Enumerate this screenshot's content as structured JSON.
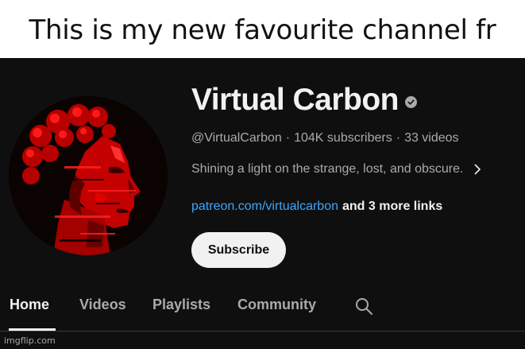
{
  "meme": {
    "caption": "This is my new favourite channel fr",
    "watermark": "imgflip.com"
  },
  "channel": {
    "name": "Virtual Carbon",
    "verified": true,
    "handle": "@VirtualCarbon",
    "subscribers": "104K subscribers",
    "videos": "33 videos",
    "separator": "·",
    "description": "Shining a light on the strange, lost, and obscure.",
    "link_primary": "patreon.com/virtualcarbon",
    "link_more": "and 3 more links",
    "subscribe_label": "Subscribe",
    "avatar_icon": "red-glitch-statue-bust"
  },
  "tabs": [
    {
      "label": "Home",
      "active": true
    },
    {
      "label": "Videos",
      "active": false
    },
    {
      "label": "Playlists",
      "active": false
    },
    {
      "label": "Community",
      "active": false
    }
  ],
  "icons": {
    "search": "search-icon",
    "verified": "verified-checkmark-icon",
    "expand": "chevron-right-icon"
  },
  "colors": {
    "background": "#0f0f0f",
    "primary_text": "#f1f1f1",
    "secondary_text": "#aaaaaa",
    "link": "#3ea6ff",
    "subscribe_bg": "#f1f1f1",
    "avatar_red": "#d40000"
  }
}
